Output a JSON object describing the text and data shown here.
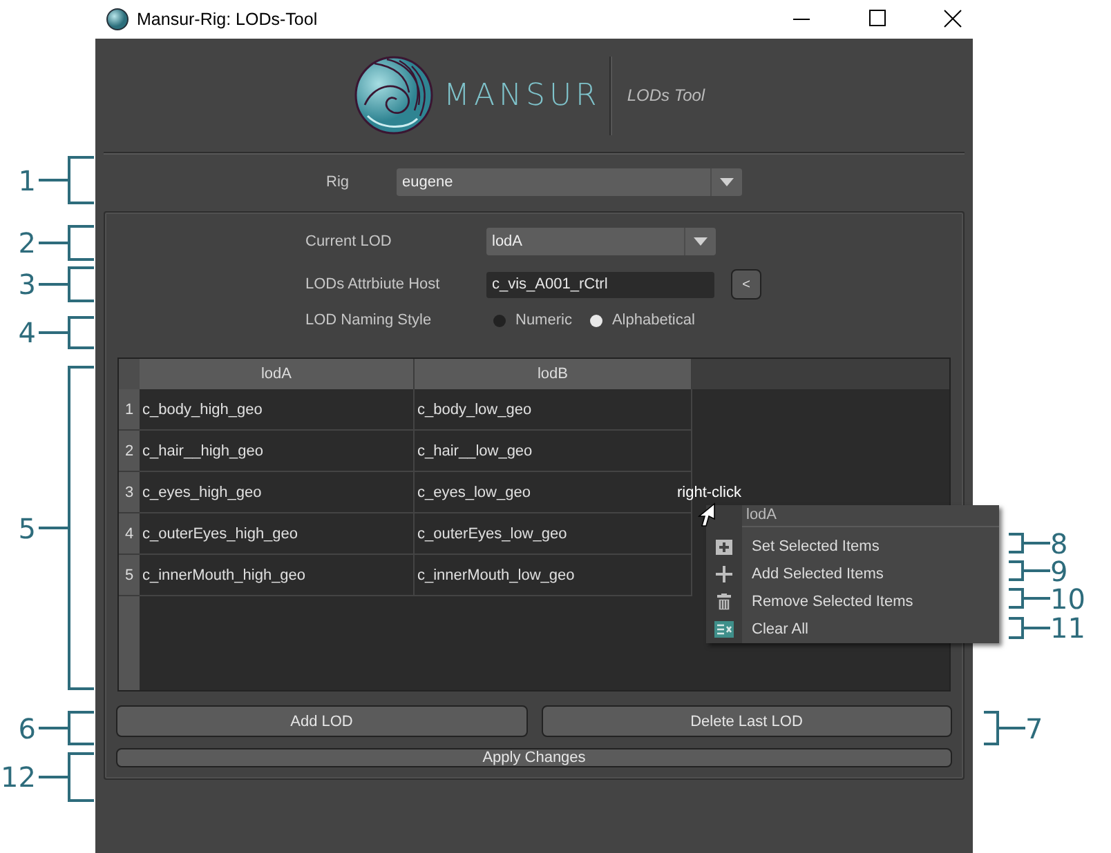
{
  "window": {
    "title": "Mansur-Rig: LODs-Tool"
  },
  "header": {
    "brand": "MANSUR",
    "subtitle": "LODs Tool"
  },
  "rig": {
    "label": "Rig",
    "value": "eugene"
  },
  "current_lod": {
    "label": "Current LOD",
    "value": "lodA"
  },
  "attribute_host": {
    "label": "LODs Attrbiute Host",
    "value": "c_vis_A001_rCtrl",
    "button": "<"
  },
  "naming_style": {
    "label": "LOD Naming Style",
    "options": [
      {
        "label": "Numeric",
        "selected": false
      },
      {
        "label": "Alphabetical",
        "selected": true
      }
    ]
  },
  "table": {
    "columns": [
      "lodA",
      "lodB"
    ],
    "rows": [
      {
        "index": "1",
        "cells": [
          "c_body_high_geo",
          "c_body_low_geo"
        ]
      },
      {
        "index": "2",
        "cells": [
          "c_hair__high_geo",
          "c_hair__low_geo"
        ]
      },
      {
        "index": "3",
        "cells": [
          "c_eyes_high_geo",
          "c_eyes_low_geo"
        ]
      },
      {
        "index": "4",
        "cells": [
          "c_outerEyes_high_geo",
          "c_outerEyes_low_geo"
        ]
      },
      {
        "index": "5",
        "cells": [
          "c_innerMouth_high_geo",
          "c_innerMouth_low_geo"
        ]
      }
    ]
  },
  "context_menu": {
    "hint": "right-click",
    "title": "lodA",
    "items": [
      {
        "label": "Set Selected Items",
        "kind": "set"
      },
      {
        "label": "Add Selected Items",
        "kind": "add"
      },
      {
        "label": "Remove Selected Items",
        "kind": "remove"
      },
      {
        "label": "Clear All",
        "kind": "clear"
      }
    ]
  },
  "buttons": {
    "add": "Add LOD",
    "delete": "Delete Last LOD",
    "apply": "Apply Changes"
  },
  "annotations": [
    {
      "number": "1",
      "kind": "left"
    },
    {
      "number": "2",
      "kind": "left"
    },
    {
      "number": "3",
      "kind": "left"
    },
    {
      "number": "4",
      "kind": "left"
    },
    {
      "number": "5",
      "kind": "left"
    },
    {
      "number": "6",
      "kind": "left"
    },
    {
      "number": "7",
      "kind": "right"
    },
    {
      "number": "8",
      "kind": "right"
    },
    {
      "number": "9",
      "kind": "right"
    },
    {
      "number": "10",
      "kind": "right"
    },
    {
      "number": "11",
      "kind": "right"
    },
    {
      "number": "12",
      "kind": "left"
    }
  ]
}
